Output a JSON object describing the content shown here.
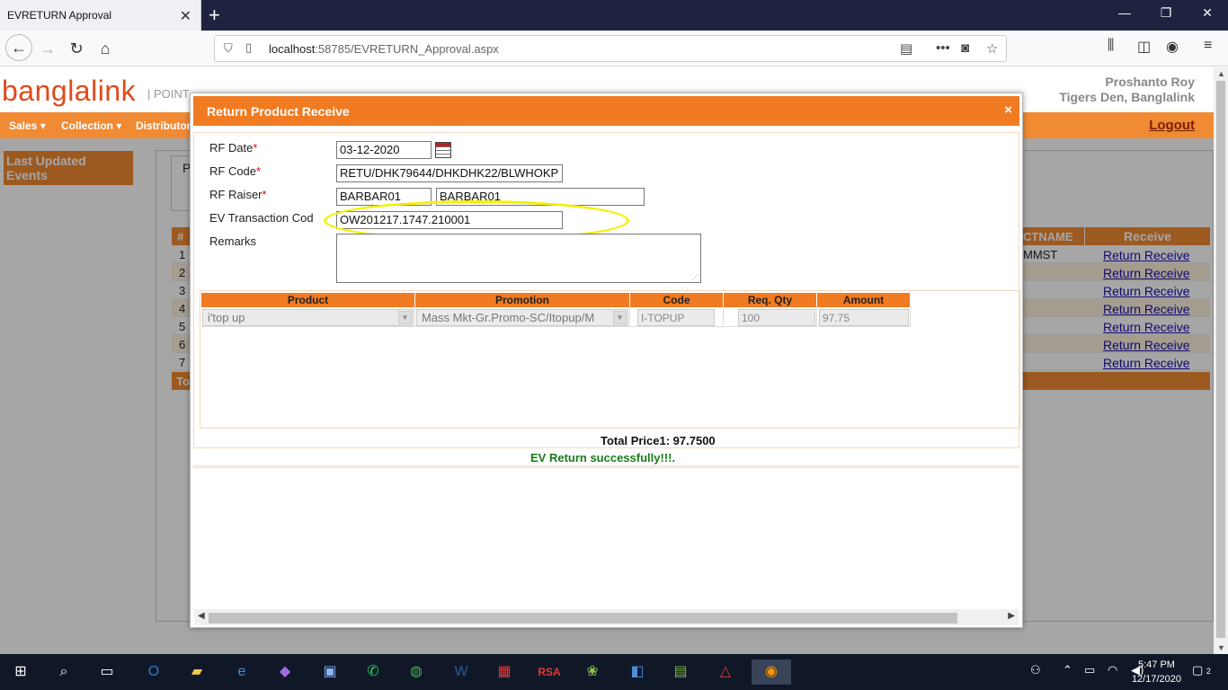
{
  "browser": {
    "tab_title": "EVRETURN Approval",
    "url_host": "localhost",
    "url_rest": ":58785/EVRETURN_Approval.aspx"
  },
  "header": {
    "logo": "banglalink",
    "logo_suffix": "| POINT",
    "user_name": "Proshanto Roy",
    "user_org": "Tigers Den, Banglalink",
    "logout": "Logout"
  },
  "menu": [
    {
      "label": "Sales"
    },
    {
      "label": "Collection"
    },
    {
      "label": "Distributor"
    }
  ],
  "sidebar": {
    "title": "Last Updated Events"
  },
  "bg_table": {
    "p_label": "P",
    "hash": "#",
    "col_name": "CTNAME",
    "col_receive": "Receive",
    "rows": [
      {
        "num": "1",
        "name": "MMST",
        "link": "Return Receive"
      },
      {
        "num": "2",
        "name": "",
        "link": "Return Receive"
      },
      {
        "num": "3",
        "name": "",
        "link": "Return Receive"
      },
      {
        "num": "4",
        "name": "",
        "link": "Return Receive"
      },
      {
        "num": "5",
        "name": "",
        "link": "Return Receive"
      },
      {
        "num": "6",
        "name": "",
        "link": "Return Receive"
      },
      {
        "num": "7",
        "name": "",
        "link": "Return Receive"
      }
    ],
    "total_label": "To"
  },
  "modal": {
    "title": "Return Product Receive",
    "close": "×",
    "fields": {
      "rf_date_label": "RF Date",
      "rf_date_value": "03-12-2020",
      "rf_code_label": "RF Code",
      "rf_code_value": "RETU/DHK79644/DHKDHK22/BLWHOKP",
      "rf_raiser_label": "RF Raiser",
      "rf_raiser_value1": "BARBAR01",
      "rf_raiser_value2": "BARBAR01",
      "ev_txn_label": "EV Transaction Cod",
      "ev_txn_value": "OW201217.1747.210001",
      "remarks_label": "Remarks",
      "required_mark": "*"
    },
    "grid": {
      "headers": [
        "Product",
        "Promotion",
        "Code",
        "Req. Qty",
        "Amount"
      ],
      "row": {
        "product": "i'top up",
        "promotion": "Mass Mkt-Gr.Promo-SC/Itopup/M",
        "code": "I-TOPUP",
        "req_qty": "100",
        "amount": "97.75"
      }
    },
    "total_price": "Total Price1:  97.7500",
    "success_msg": "EV Return successfully!!!."
  },
  "taskbar": {
    "time": "5:47 PM",
    "date": "12/17/2020",
    "notif_count": "2",
    "badge_count": "2"
  }
}
